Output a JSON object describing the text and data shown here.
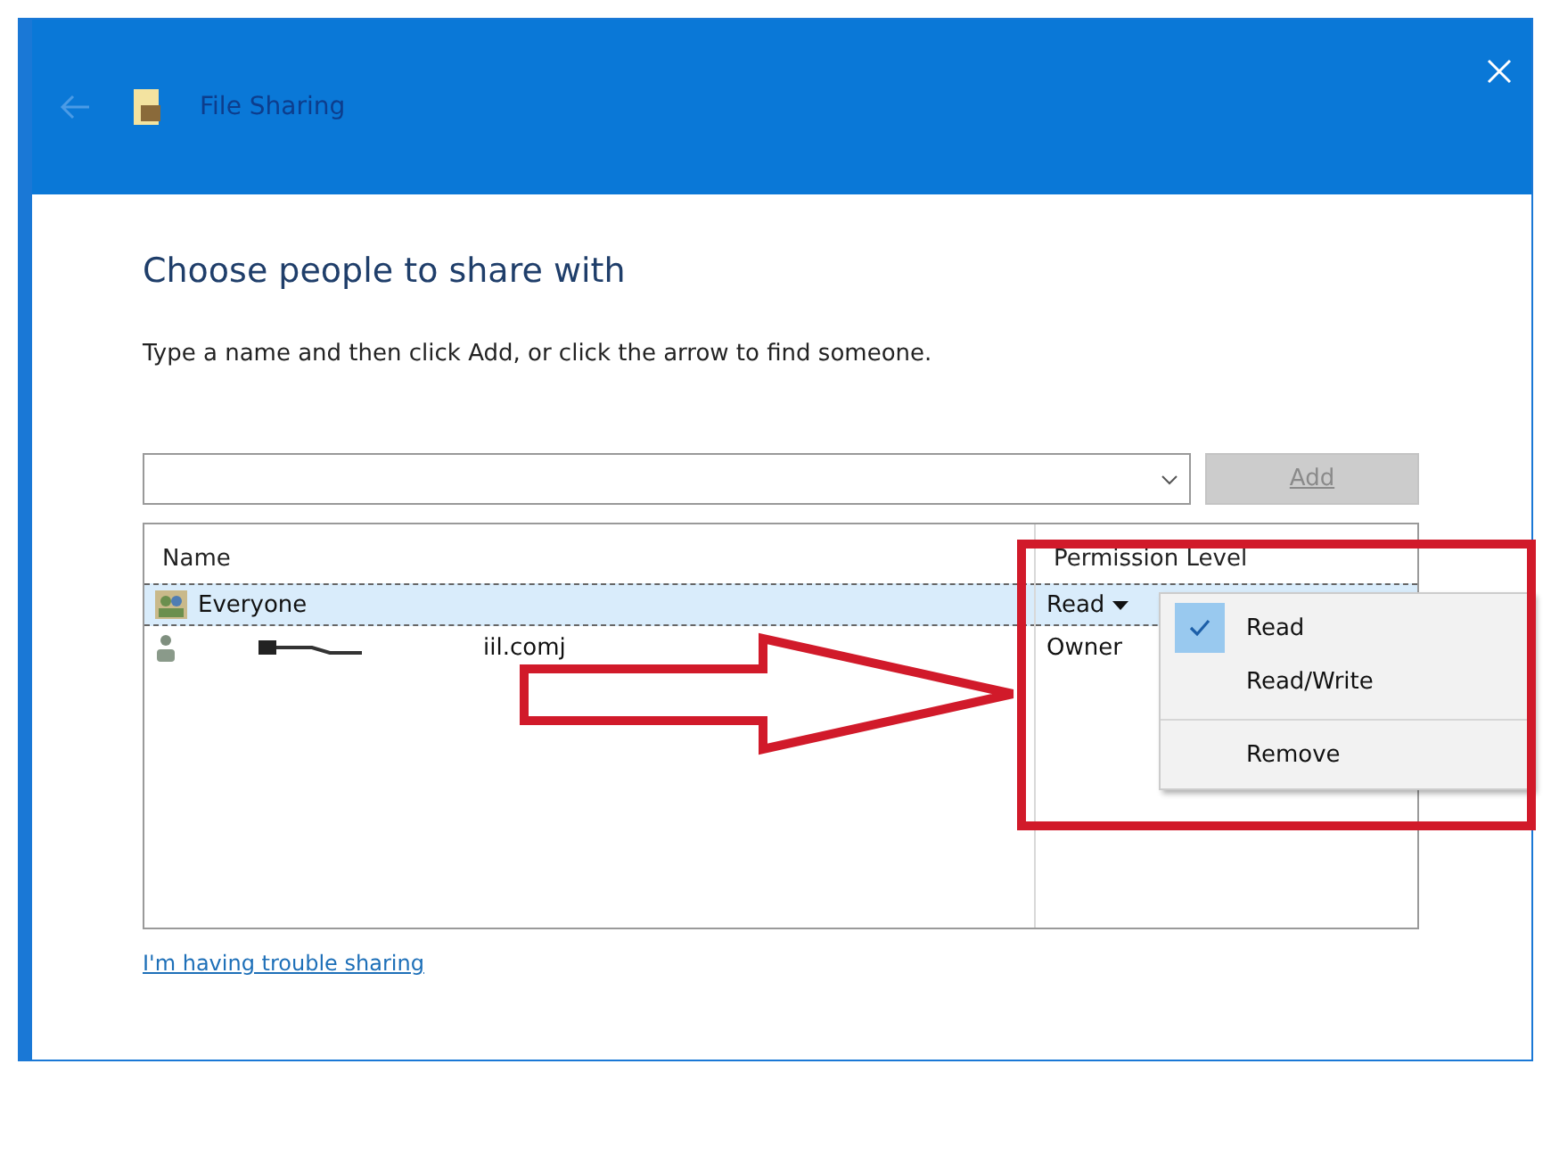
{
  "window": {
    "title": "File Sharing",
    "back_disabled": true
  },
  "heading": "Choose people to share with",
  "instruction": "Type a name and then click Add, or click the arrow to find someone.",
  "add_button": {
    "label": "Add",
    "disabled": true
  },
  "table": {
    "columns": [
      "Name",
      "Permission Level"
    ],
    "rows": [
      {
        "kind": "group",
        "name": "Everyone",
        "permission": "Read",
        "selected": true,
        "redacted": false
      },
      {
        "kind": "user",
        "name": "iil.comj",
        "permission": "Owner",
        "selected": false,
        "redacted": true
      }
    ]
  },
  "permission_menu": {
    "items": [
      {
        "kind": "option",
        "label": "Read",
        "checked": true
      },
      {
        "kind": "option",
        "label": "Read/Write",
        "checked": false
      },
      {
        "kind": "action",
        "label": "Remove",
        "checked": false
      }
    ]
  },
  "help_link": "I'm having trouble sharing"
}
